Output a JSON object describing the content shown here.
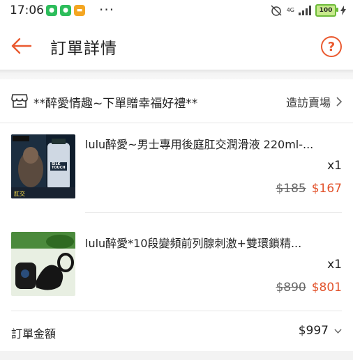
{
  "status_bar": {
    "time": "17:06",
    "network": "4G",
    "battery": "100"
  },
  "header": {
    "title": "訂單詳情",
    "back_icon": "arrow-left-icon",
    "help_icon": "question-circle-icon",
    "help_glyph": "?"
  },
  "shop": {
    "name": "**醉愛情趣~下單贈幸福好禮**",
    "visit_label": "造訪賣場",
    "icon": "shop-icon"
  },
  "products": [
    {
      "name": "lulu醉愛~男士專用後庭肛交潤滑液 220ml-...",
      "qty": "x1",
      "original_price": "$185",
      "price": "$167",
      "thumb_text_top": "SILK TOUCH",
      "thumb_text_bottom": "肛交"
    },
    {
      "name": "lulu醉愛*10段變頻前列腺刺激+雙環鎖精...",
      "qty": "x1",
      "original_price": "$890",
      "price": "$801"
    }
  ],
  "total": {
    "label": "訂單金額",
    "value": "$997"
  },
  "colors": {
    "accent": "#e2522b",
    "help": "#ea5a30",
    "battery": "#6dbb3a"
  }
}
